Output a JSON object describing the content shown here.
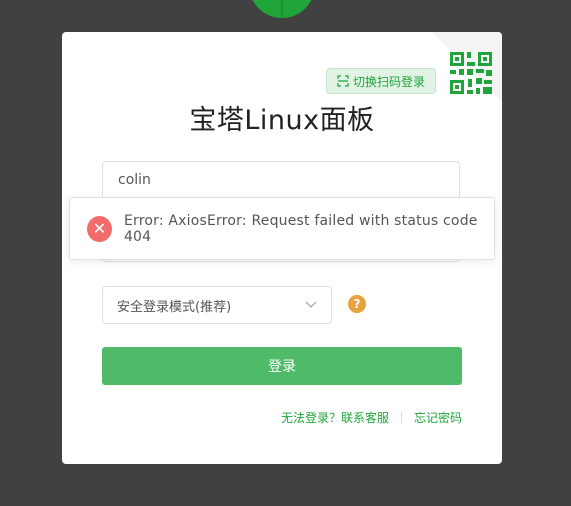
{
  "app": {
    "title": "宝塔Linux面板"
  },
  "login": {
    "qr_switch_label": "切换扫码登录",
    "username_value": "colin",
    "security_mode": "安全登录模式(推荐)",
    "help_glyph": "?",
    "login_button": "登录",
    "cant_login": "无法登录？联系客服",
    "forgot_password": "忘记密码"
  },
  "toast": {
    "message": "Error: AxiosError: Request failed with status code 404"
  },
  "colors": {
    "brand": "#20a53a",
    "button": "#4fba67",
    "error": "#f26c6c",
    "warning": "#e6a23c"
  },
  "icons": {
    "qr": "qr-code-icon",
    "scan": "scan-icon",
    "chevron": "chevron-down-icon",
    "close": "close-icon",
    "help": "question-icon"
  }
}
